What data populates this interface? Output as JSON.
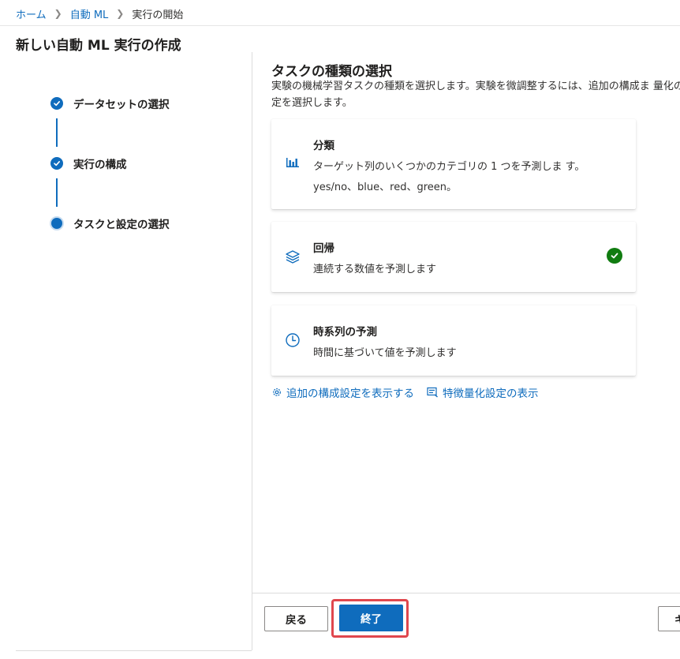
{
  "breadcrumb": {
    "home": "ホーム",
    "automl": "自動 ML",
    "current": "実行の開始"
  },
  "page": {
    "title": "新しい自動 ML 実行の作成"
  },
  "steps": [
    {
      "label": "データセットの選択",
      "status": "completed"
    },
    {
      "label": "実行の構成",
      "status": "completed"
    },
    {
      "label": "タスクと設定の選択",
      "status": "current"
    }
  ],
  "task_section": {
    "title": "タスクの種類の選択",
    "description": "実験の機械学習タスクの種類を選択します。実験を微調整するには、追加の構成ま 量化の設定を選択します。"
  },
  "task_cards": [
    {
      "icon": "bar-chart-icon",
      "title": "分類",
      "description": "ターゲット列のいくつかのカテゴリの 1 つを予測しま す。yes/no、blue、red、green。",
      "selected": false
    },
    {
      "icon": "layers-icon",
      "title": "回帰",
      "description": "連続する数値を予測します",
      "selected": true
    },
    {
      "icon": "clock-icon",
      "title": "時系列の予測",
      "description": "時間に基づいて値を予測します",
      "selected": false
    }
  ],
  "links": {
    "additional_config": "追加の構成設定を表示する",
    "featurization": "特徴量化設定の表示"
  },
  "footer": {
    "back": "戻る",
    "finish": "終了",
    "next": "キ"
  },
  "colors": {
    "accent": "#0f6cbd",
    "success": "#107c10",
    "highlight": "#e0474e"
  }
}
